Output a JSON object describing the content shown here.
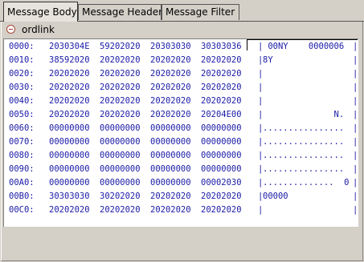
{
  "tabs": [
    {
      "label": "Message Body",
      "active": true
    },
    {
      "label": "Message Header",
      "active": false
    },
    {
      "label": "Message Filter",
      "active": false
    }
  ],
  "panel": {
    "title": "ordlink"
  },
  "hex_rows": [
    {
      "addr": "0000:",
      "w": [
        "2030304E",
        "59202020",
        "20303030",
        "30303036"
      ],
      "ascii": " 00NY    0000006"
    },
    {
      "addr": "0010:",
      "w": [
        "38592020",
        "20202020",
        "20202020",
        "20202020"
      ],
      "ascii": "8Y              "
    },
    {
      "addr": "0020:",
      "w": [
        "20202020",
        "20202020",
        "20202020",
        "20202020"
      ],
      "ascii": "                "
    },
    {
      "addr": "0030:",
      "w": [
        "20202020",
        "20202020",
        "20202020",
        "20202020"
      ],
      "ascii": "                "
    },
    {
      "addr": "0040:",
      "w": [
        "20202020",
        "20202020",
        "20202020",
        "20202020"
      ],
      "ascii": "                "
    },
    {
      "addr": "0050:",
      "w": [
        "20202020",
        "20202020",
        "20202020",
        "20204E00"
      ],
      "ascii": "              N."
    },
    {
      "addr": "0060:",
      "w": [
        "00000000",
        "00000000",
        "00000000",
        "00000000"
      ],
      "ascii": "................"
    },
    {
      "addr": "0070:",
      "w": [
        "00000000",
        "00000000",
        "00000000",
        "00000000"
      ],
      "ascii": "................"
    },
    {
      "addr": "0080:",
      "w": [
        "00000000",
        "00000000",
        "00000000",
        "00000000"
      ],
      "ascii": "................"
    },
    {
      "addr": "0090:",
      "w": [
        "00000000",
        "00000000",
        "00000000",
        "00000000"
      ],
      "ascii": "................"
    },
    {
      "addr": "00A0:",
      "w": [
        "00000000",
        "00000000",
        "00000000",
        "00002030"
      ],
      "ascii": "..............  0"
    },
    {
      "addr": "00B0:",
      "w": [
        "30303030",
        "30202020",
        "20202020",
        "20202020"
      ],
      "ascii": "00000           "
    },
    {
      "addr": "00C0:",
      "w": [
        "20202020",
        "20202020",
        "20202020",
        "20202020"
      ],
      "ascii": "                "
    }
  ]
}
